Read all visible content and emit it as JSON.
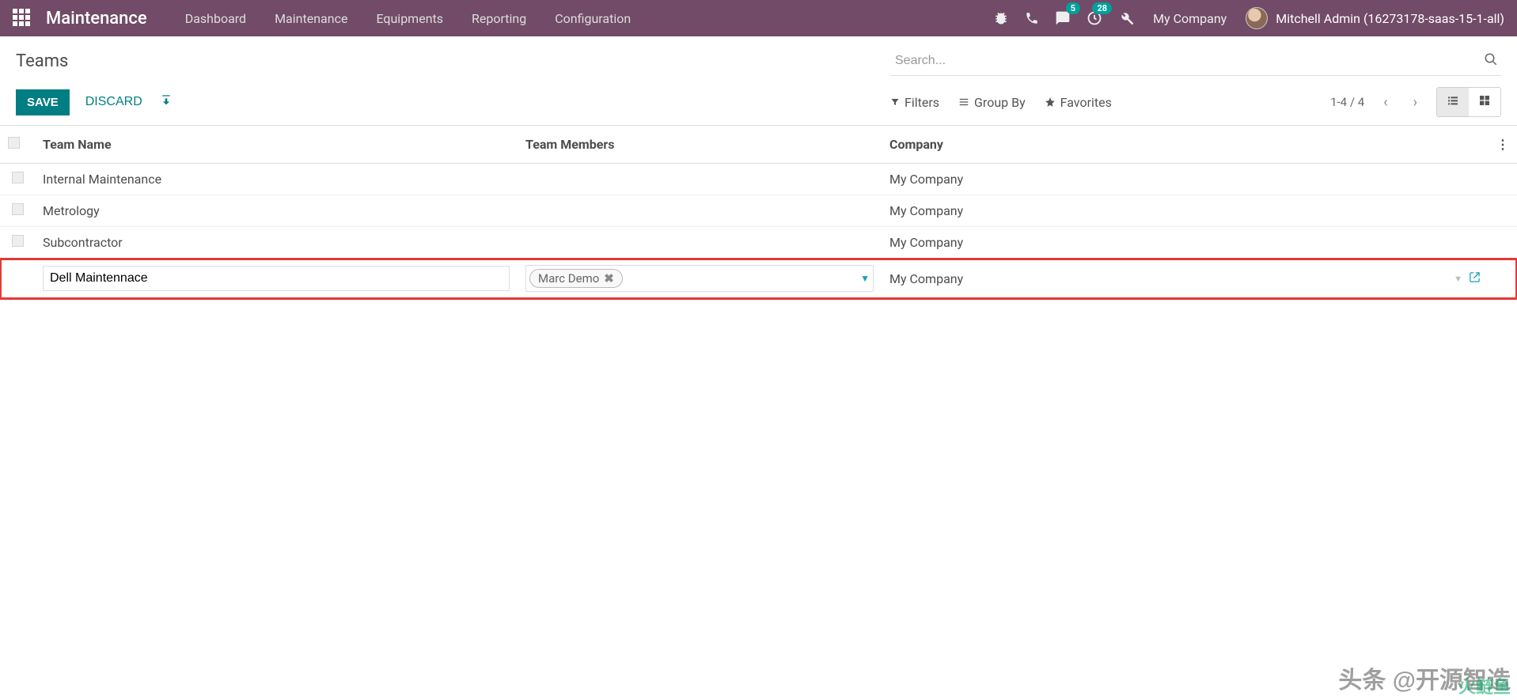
{
  "nav": {
    "app_title": "Maintenance",
    "items": [
      "Dashboard",
      "Maintenance",
      "Equipments",
      "Reporting",
      "Configuration"
    ],
    "company": "My Company",
    "user": "Mitchell Admin (16273178-saas-15-1-all)",
    "msg_badge": "5",
    "activity_badge": "28"
  },
  "cp": {
    "breadcrumb": "Teams",
    "search_placeholder": "Search...",
    "save": "SAVE",
    "discard": "DISCARD",
    "filters": "Filters",
    "groupby": "Group By",
    "favorites": "Favorites",
    "pager": "1-4 / 4"
  },
  "table": {
    "headers": {
      "name": "Team Name",
      "members": "Team Members",
      "company": "Company"
    },
    "rows": [
      {
        "name": "Internal Maintenance",
        "company": "My Company"
      },
      {
        "name": "Metrology",
        "company": "My Company"
      },
      {
        "name": "Subcontractor",
        "company": "My Company"
      }
    ],
    "edit_row": {
      "name": "Dell Maintennace",
      "member_tag": "Marc Demo",
      "company": "My Company"
    }
  },
  "watermark": {
    "line1": "头条 @开源智造",
    "line2": "火鲢鱼"
  }
}
